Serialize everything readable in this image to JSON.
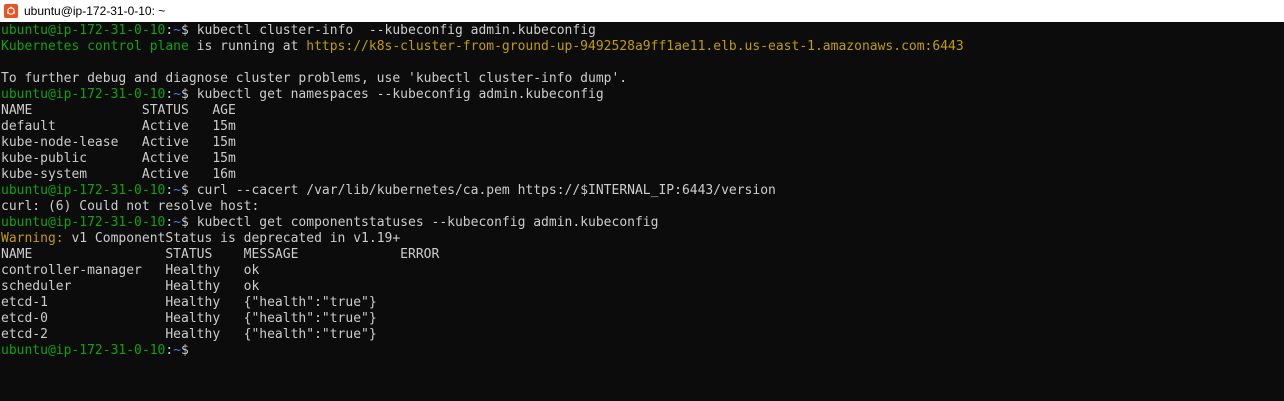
{
  "window": {
    "title": "ubuntu@ip-172-31-0-10: ~"
  },
  "colors": {
    "background": "#0c0c0c",
    "text": "#cccccc",
    "prompt_user": "#13a10e",
    "prompt_path": "#3b78ff",
    "url": "#c19c00"
  },
  "prompt": {
    "user_host": "ubuntu@ip-172-31-0-10",
    "colon": ":",
    "path": "~",
    "symbol": "$ "
  },
  "terminal": {
    "cmd1": "kubectl cluster-info  --kubeconfig admin.kubeconfig",
    "info_label": "Kubernetes control plane",
    "info_mid": " is running at ",
    "info_url": "https://k8s-cluster-from-ground-up-9492528a9ff1ae11.elb.us-east-1.amazonaws.com:6443",
    "debug_msg": "To further debug and diagnose cluster problems, use 'kubectl cluster-info dump'.",
    "cmd2": "kubectl get namespaces --kubeconfig admin.kubeconfig",
    "ns_header": "NAME              STATUS   AGE",
    "ns_rows": [
      "default           Active   15m",
      "kube-node-lease   Active   15m",
      "kube-public       Active   15m",
      "kube-system       Active   16m"
    ],
    "cmd3": "curl --cacert /var/lib/kubernetes/ca.pem https://$INTERNAL_IP:6443/version",
    "curl_error": "curl: (6) Could not resolve host:",
    "cmd4": "kubectl get componentstatuses --kubeconfig admin.kubeconfig",
    "warning_label": "Warning:",
    "warning_msg": " v1 ComponentStatus is deprecated in v1.19+",
    "cs_header": "NAME                 STATUS    MESSAGE             ERROR",
    "cs_rows": [
      "controller-manager   Healthy   ok",
      "scheduler            Healthy   ok",
      "etcd-1               Healthy   {\"health\":\"true\"}",
      "etcd-0               Healthy   {\"health\":\"true\"}",
      "etcd-2               Healthy   {\"health\":\"true\"}"
    ]
  }
}
